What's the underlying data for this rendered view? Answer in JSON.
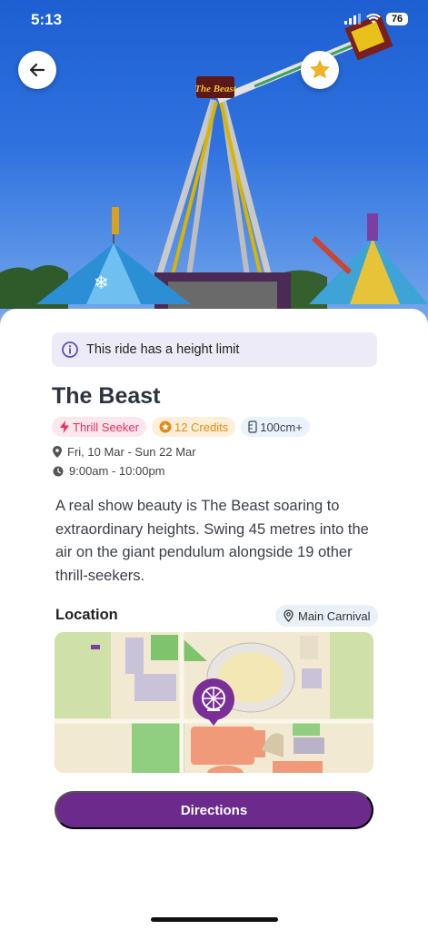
{
  "status_bar": {
    "time": "5:13",
    "battery": "76"
  },
  "ride_sign": "The Beast",
  "notice": {
    "text": "This ride has a height limit"
  },
  "ride": {
    "title": "The Beast",
    "tags": [
      {
        "label": "Thrill Seeker",
        "icon": "lightning-icon"
      },
      {
        "label": "12 Credits",
        "icon": "credits-star-icon"
      },
      {
        "label": "100cm+",
        "icon": "height-ruler-icon"
      }
    ],
    "dates": "Fri, 10 Mar - Sun 22 Mar",
    "hours": "9:00am - 10:00pm",
    "description": "A real show beauty is The Beast soaring to extraordinary heights. Swing 45 metres into the air on the giant pendulum alongside 19 other thrill-seekers."
  },
  "location": {
    "heading": "Location",
    "area": "Main Carnival"
  },
  "actions": {
    "directions_label": "Directions"
  },
  "colors": {
    "brand_purple": "#6b2a8c",
    "favorite_star": "#f5b323",
    "tag_pink": "#e0305f",
    "tag_orange": "#e58a10",
    "notice_bg": "#ecebf7"
  },
  "icons": {
    "back": "arrow-left-icon",
    "favorite": "star-icon",
    "notice": "info-icon",
    "date": "location-pin-icon",
    "time": "clock-icon",
    "map_marker": "ferris-wheel-marker-icon"
  }
}
